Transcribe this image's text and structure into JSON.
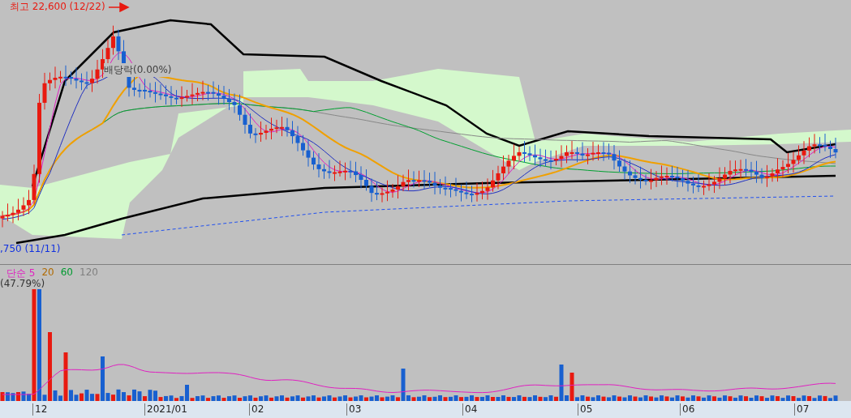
{
  "price_panel": {
    "high_label": "최고 22,600 (12/22)",
    "dividend_label": "배당락(0.00%)",
    "low_label": ",750 (11/11)"
  },
  "volume_panel": {
    "legend": [
      {
        "text": "단순 5",
        "color": "#e020c0"
      },
      {
        "text": "20",
        "color": "#b06a00"
      },
      {
        "text": "60",
        "color": "#009a30"
      },
      {
        "text": "120",
        "color": "#808080"
      }
    ],
    "ratio_label": "(47.79%)"
  },
  "date_axis": {
    "ticks": [
      "12",
      "2021/01",
      "02",
      "03",
      "04",
      "05",
      "06",
      "07"
    ]
  }
}
